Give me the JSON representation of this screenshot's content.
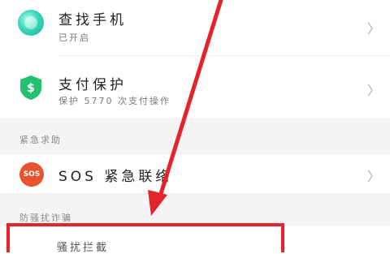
{
  "items": {
    "find_phone": {
      "title": "查找手机",
      "subtitle": "已开启",
      "chevron": "〉",
      "icon": "find-phone-icon"
    },
    "pay_protect": {
      "title": "支付保护",
      "subtitle": "保护 5770 次支付操作",
      "chevron": "〉",
      "icon": "shield-dollar-icon"
    },
    "sos": {
      "title": "SOS 紧急联络",
      "icon_text": "SOS",
      "chevron": "〉"
    }
  },
  "sections": {
    "emergency": "紧急求助",
    "anti_fraud": "防骚扰诈骗"
  },
  "highlighted_item": {
    "partial_text": "骚扰拦截"
  },
  "annotation": {
    "arrow_color": "#e3242b",
    "box_color": "#e3242b"
  }
}
